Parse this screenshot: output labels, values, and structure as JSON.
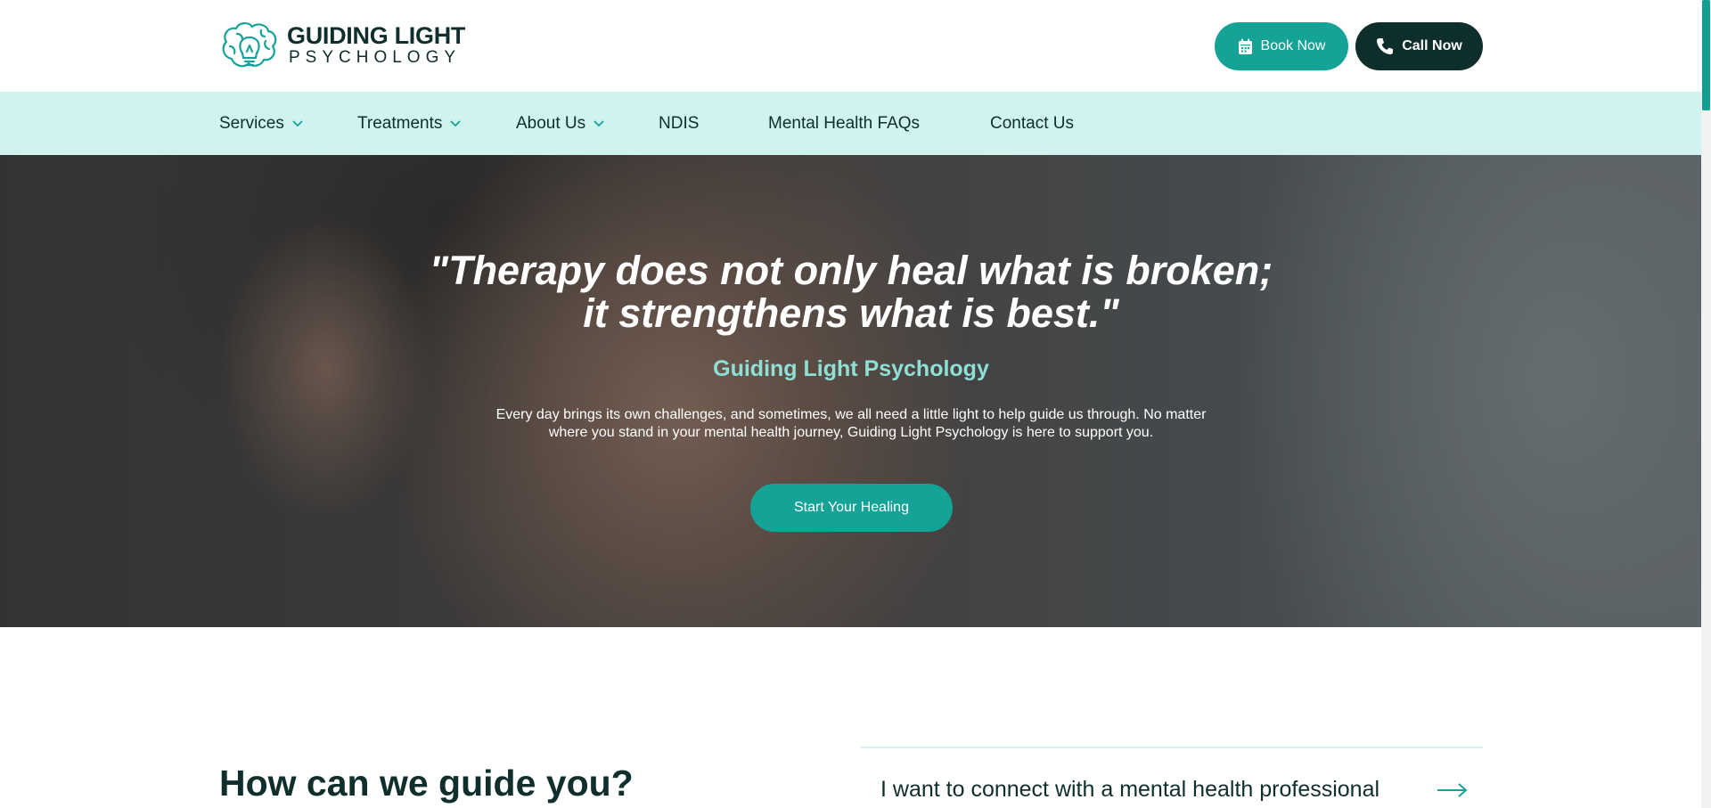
{
  "header": {
    "logo": {
      "title": "GUIDING LIGHT",
      "subtitle": "PSYCHOLOGY",
      "icon": "brain-lightbulb-icon"
    },
    "book_button": {
      "label": "Book Now",
      "icon": "calendar-icon"
    },
    "call_button": {
      "label": "Call Now",
      "icon": "phone-icon"
    }
  },
  "nav": {
    "items": [
      {
        "label": "Services",
        "has_dropdown": true
      },
      {
        "label": "Treatments",
        "has_dropdown": true
      },
      {
        "label": "About Us",
        "has_dropdown": true
      },
      {
        "label": "NDIS",
        "has_dropdown": false
      },
      {
        "label": "Mental Health FAQs",
        "has_dropdown": false
      },
      {
        "label": "Contact Us",
        "has_dropdown": false
      }
    ]
  },
  "hero": {
    "quote_line1": "\"Therapy does not only heal what is broken;",
    "quote_line2": "it strengthens what is best.\"",
    "subtitle": "Guiding Light Psychology",
    "body_line1": "Every day brings its own challenges, and sometimes, we all need a little light to help guide us through. No matter",
    "body_line2": "where you stand in your mental health journey, Guiding Light Psychology is here to support you.",
    "cta": "Start Your Healing"
  },
  "guide": {
    "heading": "How can we guide you?",
    "link": "I want to connect with a mental health professional",
    "link_icon": "arrow-right-icon"
  },
  "colors": {
    "teal": "#14a396",
    "dark": "#0d2e2b",
    "nav_bg": "#d0f3f0",
    "accent_text": "#8ee0d6"
  }
}
